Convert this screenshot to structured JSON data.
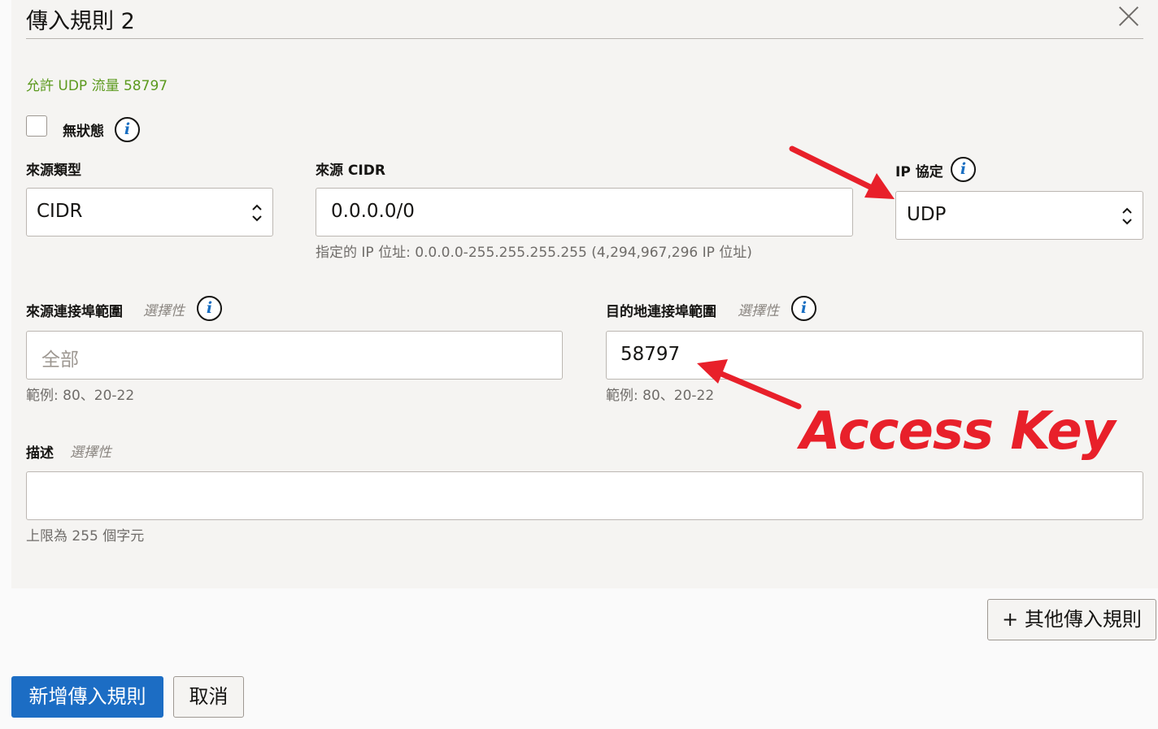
{
  "dialog": {
    "title": "傳入規則 2",
    "subtitle": "允許 UDP 流量 58797"
  },
  "stateless": {
    "label": "無狀態",
    "checked": false
  },
  "source_type": {
    "label": "來源類型",
    "value": "CIDR"
  },
  "source_cidr": {
    "label": "來源 CIDR",
    "value": "0.0.0.0/0",
    "hint": "指定的 IP 位址: 0.0.0.0-255.255.255.255 (4,294,967,296 IP 位址)"
  },
  "ip_protocol": {
    "label": "IP 協定",
    "value": "UDP"
  },
  "source_port": {
    "label": "來源連接埠範圍",
    "optional": "選擇性",
    "placeholder": "全部",
    "hint": "範例: 80、20-22"
  },
  "dest_port": {
    "label": "目的地連接埠範圍",
    "optional": "選擇性",
    "value": "58797",
    "hint": "範例: 80、20-22"
  },
  "description": {
    "label": "描述",
    "optional": "選擇性",
    "value": "",
    "hint": "上限為 255 個字元"
  },
  "buttons": {
    "add_more": "+ 其他傳入規則",
    "add": "新增傳入規則",
    "cancel": "取消"
  },
  "annotation": {
    "text": "Access Key",
    "color": "#e8202a"
  },
  "icons": {
    "info": "info-icon",
    "close": "close-icon",
    "spinner": "chevron-updown-icon"
  }
}
